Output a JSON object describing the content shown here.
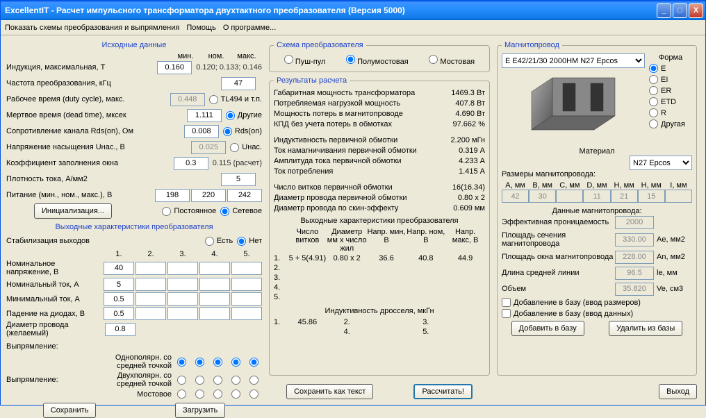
{
  "window": {
    "title": "ExcellentIT - Расчет импульсного трансформатора двухтактного преобразователя (Версия 5000)"
  },
  "menu": {
    "i0": "Показать схемы преобразования и выпрямления",
    "i1": "Помощь",
    "i2": "О программе..."
  },
  "src": {
    "title": "Исходные данные",
    "minmax": {
      "min": "мин.",
      "nom": "ном.",
      "max": "макс."
    },
    "induction": {
      "label": "Индукция, максимальная, T",
      "val": "0.160",
      "hint": "0.120; 0.133; 0.146"
    },
    "freq": {
      "label": "Частота преобразования, кГц",
      "val": "47"
    },
    "duty": {
      "label": "Рабочее время (duty cycle), макс.",
      "val": "0.448",
      "r1": "TL494 и т.п.",
      "r2": "Другие"
    },
    "dead": {
      "label": "Мертвое время (dead time), мксек",
      "val": "1.111"
    },
    "rds": {
      "label": "Сопротивление канала Rds(on), Ом",
      "val": "0.008",
      "r1": "Rds(on)"
    },
    "usat": {
      "label": "Напряжение насыщения Uнас., В",
      "val": "0.025",
      "r1": "Uнас."
    },
    "kfill": {
      "label": "Коэффициент заполнения окна",
      "val": "0.3",
      "hint": "0.115 (расчет)"
    },
    "jdens": {
      "label": "Плотность тока, А/мм2",
      "val": "5"
    },
    "supply": {
      "label": "Питание (мин., ном., макс.), В",
      "v1": "198",
      "v2": "220",
      "v3": "242",
      "r1": "Постоянное",
      "r2": "Сетевое"
    },
    "init": "Инициализация...",
    "outch_title": "Выходные характеристики преобразователя",
    "stab": {
      "label": "Стабилизация выходов",
      "yes": "Есть",
      "no": "Нет"
    },
    "cols": {
      "c1": "1.",
      "c2": "2.",
      "c3": "3.",
      "c4": "4.",
      "c5": "5."
    },
    "vnom": {
      "label": "Номинальное напряжение, В",
      "v1": "40"
    },
    "inom": {
      "label": "Номинальный ток, А",
      "v1": "5"
    },
    "imin": {
      "label": "Минимальный ток, А",
      "v1": "0.5"
    },
    "vdrop": {
      "label": "Падение на диодах, В",
      "v1": "0.5"
    },
    "wire": {
      "label": "Диаметр провода (желаемый)",
      "val": "0.8"
    },
    "rect": {
      "label": "Выпрямление:",
      "o1": "Однополярн. со средней точкой",
      "o2": "Двухполярн. со средней точкой",
      "o3": "Мостовое"
    },
    "save": "Сохранить",
    "load": "Загрузить"
  },
  "scheme": {
    "title": "Схема преобразователя",
    "o1": "Пуш-пул",
    "o2": "Полумостовая",
    "o3": "Мостовая"
  },
  "res": {
    "title": "Результаты расчета",
    "r1": {
      "l": "Габаритная мощность трансформатора",
      "v": "1469.3 Вт"
    },
    "r2": {
      "l": "Потребляемая нагрузкой мощность",
      "v": "407.8 Вт"
    },
    "r3": {
      "l": "Мощность потерь в магнитопроводе",
      "v": "4.690 Вт"
    },
    "r4": {
      "l": "КПД без учета потерь в обмотках",
      "v": "97.662 %"
    },
    "r5": {
      "l": "Индуктивность первичной обмотки",
      "v": "2.200 мГн"
    },
    "r6": {
      "l": "Ток намагничивания первичной обмотки",
      "v": "0.319 А"
    },
    "r7": {
      "l": "Амплитуда тока первичной обмотки",
      "v": "4.233 А"
    },
    "r8": {
      "l": "Ток потребления",
      "v": "1.415 А"
    },
    "r9": {
      "l": "Число витков первичной обмотки",
      "v": "16(16.34)"
    },
    "r10": {
      "l": "Диаметр провода первичной обмотки",
      "v": "0.80 x 2"
    },
    "r11": {
      "l": "Диаметр провода по скин-эффекту",
      "v": "0.609 мм"
    },
    "out_title": "Выходные характеристики преобразователя",
    "hdr": {
      "h1": "Число витков",
      "h2": "Диаметр мм x число жил",
      "h3": "Напр. мин, В",
      "h4": "Напр. ном, В",
      "h5": "Напр. макс, В"
    },
    "ro1": {
      "n": "1.",
      "v1": "5 + 5(4.91)",
      "v2": "0.80 x 2",
      "v3": "36.6",
      "v4": "40.8",
      "v5": "44.9"
    },
    "ro2": "2.",
    "ro3": "3.",
    "ro4": "4.",
    "ro5": "5.",
    "ind_title": "Индуктивность дросселя, мкГн",
    "ind1": {
      "n": "1.",
      "v": "45.86"
    },
    "ind2": "2.",
    "ind3": "3.",
    "ind4": "4.",
    "ind5": "5.",
    "save_txt": "Сохранить как текст",
    "calc": "Рассчитать!"
  },
  "mag": {
    "title": "Магнитопровод",
    "core_sel": "E E42/21/30 2000HM N27 Epcos",
    "shape": {
      "label": "Форма",
      "o1": "E",
      "o2": "EI",
      "o3": "ER",
      "o4": "ETD",
      "o5": "R",
      "o6": "Другая"
    },
    "mat": {
      "label": "Материал",
      "sel": "N27 Epcos"
    },
    "dims_title": "Размеры магнитопровода:",
    "dh": {
      "a": "A, мм",
      "b": "B, мм",
      "c": "C, мм",
      "d": "D, мм",
      "h": "H, мм",
      "h2": "H, мм",
      "i": "I, мм"
    },
    "dv": {
      "a": "42",
      "b": "30",
      "c": "",
      "d": "11",
      "h": "21",
      "h2": "15",
      "i": ""
    },
    "data_title": "Данные магнитопровода:",
    "perm": {
      "l": "Эффективная проницаемость",
      "v": "2000",
      "u": ""
    },
    "sae": {
      "l": "Площадь сечения магнитопровода",
      "v": "330.00",
      "u": "Ae, мм2"
    },
    "san": {
      "l": "Площадь окна магнитопровода",
      "v": "228.00",
      "u": "An, мм2"
    },
    "le": {
      "l": "Длина средней линии",
      "v": "96.5",
      "u": "le, мм"
    },
    "ve": {
      "l": "Объем",
      "v": "35.820",
      "u": "Ve, см3"
    },
    "chk1": "Добавление в базу (ввод размеров)",
    "chk2": "Добавление в базу (ввод данных)",
    "add": "Добавить в базу",
    "del": "Удалить из базы",
    "exit": "Выход"
  }
}
